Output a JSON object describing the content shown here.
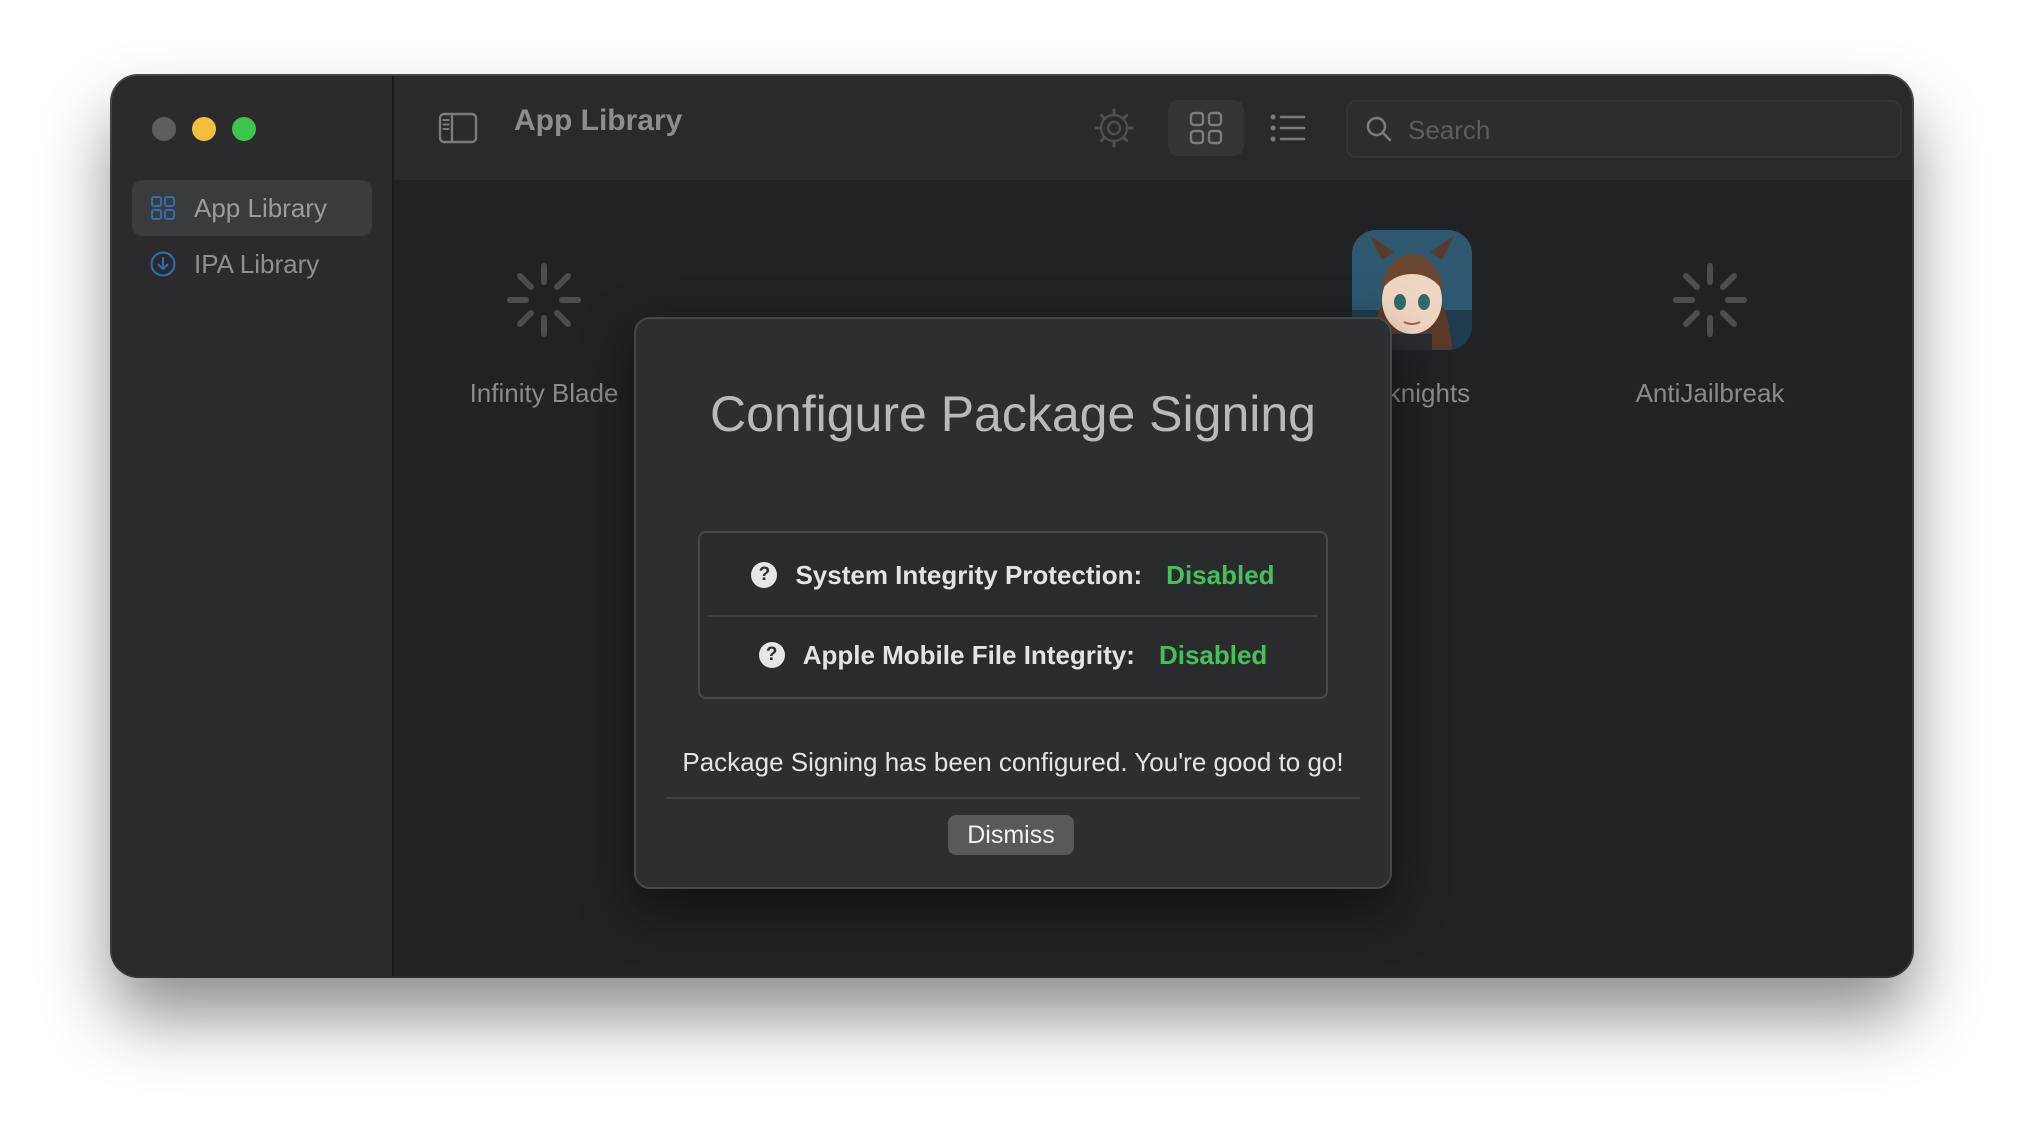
{
  "window": {
    "traffic_lights": [
      "close",
      "minimize",
      "zoom"
    ]
  },
  "sidebar": {
    "items": [
      {
        "label": "App Library",
        "icon": "grid-icon",
        "active": true
      },
      {
        "label": "IPA Library",
        "icon": "download-circle-icon",
        "active": false
      }
    ]
  },
  "toolbar": {
    "title": "App Library",
    "icons": [
      "sidebar-toggle-icon",
      "gear-icon",
      "plus-icon",
      "grid-view-icon",
      "list-view-icon"
    ],
    "search": {
      "placeholder": "Search",
      "value": ""
    }
  },
  "apps": [
    {
      "name": "Infinity Blade",
      "icon": "spinner-icon"
    },
    {
      "name": "Arknights",
      "icon": "arknights-artwork"
    },
    {
      "name": "AntiJailbreak",
      "icon": "spinner-icon"
    }
  ],
  "modal": {
    "title": "Configure Package Signing",
    "rows": [
      {
        "label": "System Integrity Protection:",
        "value": "Disabled"
      },
      {
        "label": "Apple Mobile File Integrity:",
        "value": "Disabled"
      }
    ],
    "help_glyph": "?",
    "message": "Package Signing has been configured. You're good to go!",
    "dismiss_label": "Dismiss"
  },
  "colors": {
    "status_ok": "#45c15a",
    "close": "#5e5e60",
    "minimize": "#f6bd3b",
    "zoom": "#3ec54a"
  }
}
